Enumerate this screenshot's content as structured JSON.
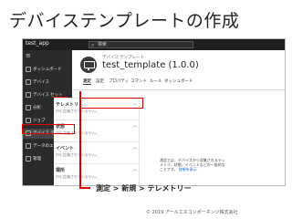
{
  "slide": {
    "title": "デバイステンプレートの作成",
    "caption": "測定 > 新規 > テレメトリー",
    "copyright": "© 2019 アールエスコンポーネンツ株式会社"
  },
  "app": {
    "name": "test_app",
    "search_placeholder": "検索"
  },
  "sidebar": {
    "items": [
      {
        "label": "ダッシュボード"
      },
      {
        "label": "デバイス"
      },
      {
        "label": "デバイス セット"
      },
      {
        "label": "分析"
      },
      {
        "label": "ジョブ"
      },
      {
        "label": "デバイス テンプレート"
      },
      {
        "label": "データのエクスポート"
      },
      {
        "label": "管理"
      }
    ]
  },
  "device": {
    "breadcrumb": "デバイス テンプレート",
    "title": "test_template (1.0.0)",
    "tabs": [
      "測定",
      "設定",
      "プロパティ",
      "コマンド",
      "ルール",
      "ダッシュボード"
    ]
  },
  "panel": {
    "new_label": "＋ 新規",
    "sections": [
      {
        "title": "テレメトリ",
        "empty": "何も定義されていません。"
      },
      {
        "title": "状態",
        "empty": "何も定義されていません。"
      },
      {
        "title": "イベント",
        "empty": "何も定義されていません。"
      },
      {
        "title": "場所",
        "empty": "何も定義されていません。"
      }
    ]
  },
  "help": {
    "text": "測定とは、デバイスから収集されるテレメトリ、状態、イベントなどの一般的なことです。",
    "link": "詳細を表示"
  },
  "colors": {
    "highlight": "#e00000",
    "sidebar_bg": "#2b2b2b",
    "topbar_bg": "#1f1f1f"
  }
}
